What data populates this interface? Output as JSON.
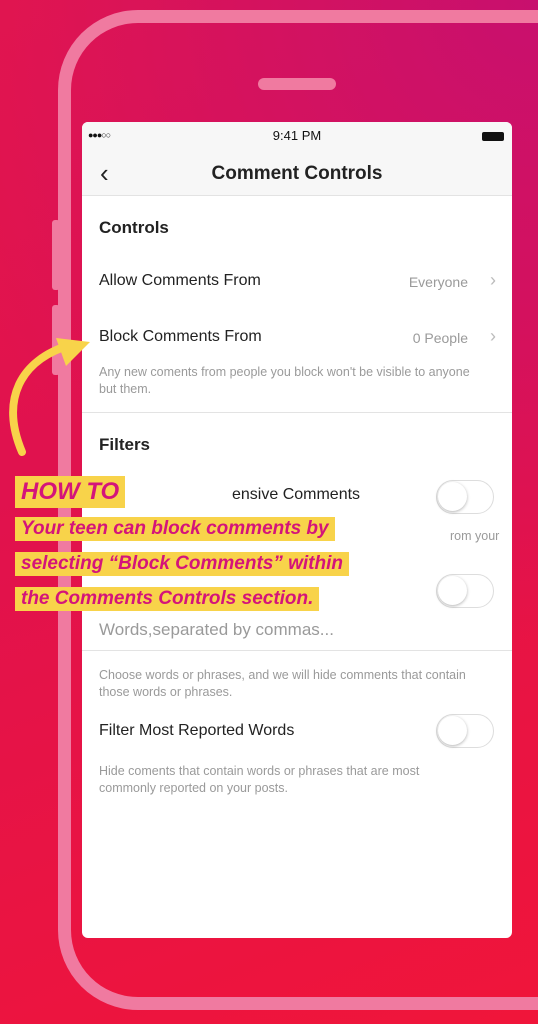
{
  "status_bar": {
    "time": "9:41 PM",
    "signal": "●●●○○"
  },
  "nav": {
    "back_glyph": "‹",
    "title": "Comment Controls"
  },
  "controls": {
    "heading": "Controls",
    "allow_label": "Allow Comments From",
    "allow_value": "Everyone",
    "block_label": "Block Comments From",
    "block_value": "0 People",
    "block_helper": "Any new coments from people you block won't be visible to anyone but them."
  },
  "filters": {
    "heading": "Filters",
    "offensive_label": "ensive Comments",
    "offensive_helper_partial": "rom your",
    "words_placeholder": "Words,separated by commas...",
    "words_helper": "Choose words or phrases, and we will hide comments that contain those words or phrases.",
    "most_reported_label": "Filter Most Reported Words",
    "most_reported_helper": "Hide coments that contain words or phrases that are most commonly reported on your posts."
  },
  "callout": {
    "title": "HOW TO",
    "line1": "Your teen can block comments by",
    "line2": "selecting “Block Comments” within",
    "line3": "the Comments Controls section."
  },
  "colors": {
    "highlight": "#f8d34a",
    "text_pink": "#d4147a",
    "frame": "#f07aa0"
  }
}
